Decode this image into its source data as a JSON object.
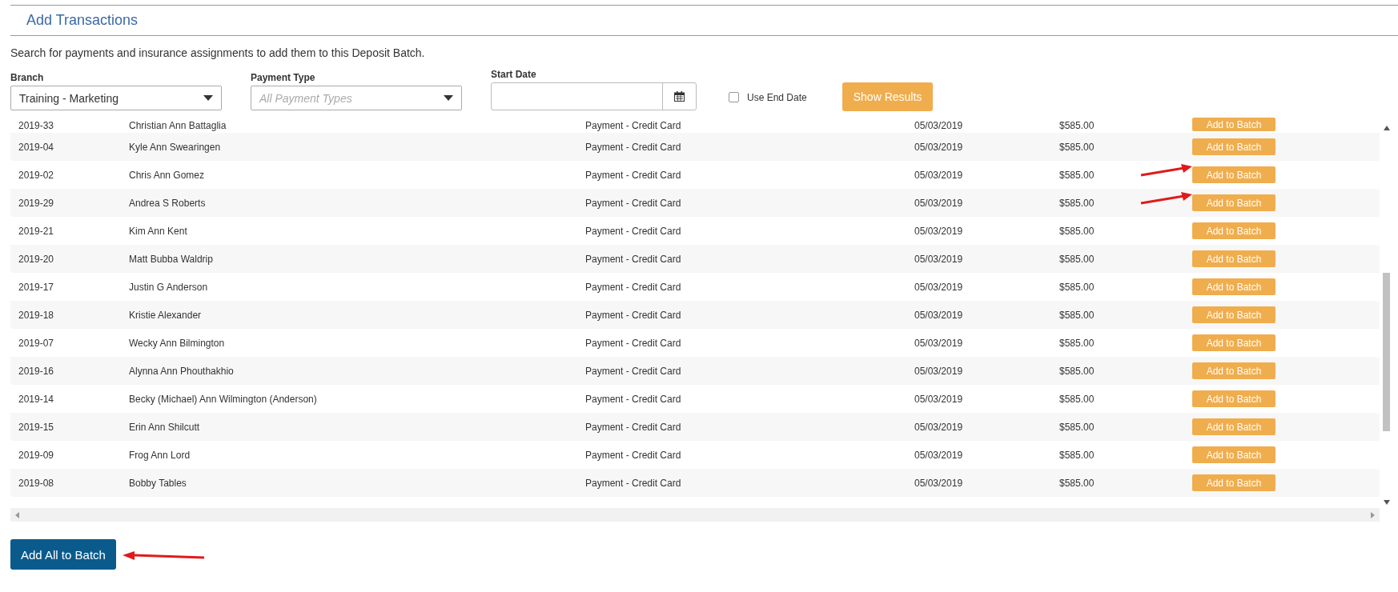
{
  "section": {
    "title": "Add Transactions",
    "description": "Search for payments and insurance assignments to add them to this Deposit Batch."
  },
  "filters": {
    "branch": {
      "label": "Branch",
      "value": "Training - Marketing"
    },
    "payment_type": {
      "label": "Payment Type",
      "placeholder": "All Payment Types"
    },
    "start_date": {
      "label": "Start Date"
    },
    "use_end_date": {
      "label": "Use End Date",
      "checked": false
    },
    "show_results": "Show Results"
  },
  "rows": [
    {
      "id": "2019-33",
      "name": "Christian Ann Battaglia",
      "type": "Payment - Credit Card",
      "date": "05/03/2019",
      "amount": "$585.00",
      "action": "Add to Batch"
    },
    {
      "id": "2019-04",
      "name": "Kyle Ann Swearingen",
      "type": "Payment - Credit Card",
      "date": "05/03/2019",
      "amount": "$585.00",
      "action": "Add to Batch"
    },
    {
      "id": "2019-02",
      "name": "Chris Ann Gomez",
      "type": "Payment - Credit Card",
      "date": "05/03/2019",
      "amount": "$585.00",
      "action": "Add to Batch"
    },
    {
      "id": "2019-29",
      "name": "Andrea S Roberts",
      "type": "Payment - Credit Card",
      "date": "05/03/2019",
      "amount": "$585.00",
      "action": "Add to Batch"
    },
    {
      "id": "2019-21",
      "name": "Kim Ann Kent",
      "type": "Payment - Credit Card",
      "date": "05/03/2019",
      "amount": "$585.00",
      "action": "Add to Batch"
    },
    {
      "id": "2019-20",
      "name": "Matt Bubba Waldrip",
      "type": "Payment - Credit Card",
      "date": "05/03/2019",
      "amount": "$585.00",
      "action": "Add to Batch"
    },
    {
      "id": "2019-17",
      "name": "Justin G Anderson",
      "type": "Payment - Credit Card",
      "date": "05/03/2019",
      "amount": "$585.00",
      "action": "Add to Batch"
    },
    {
      "id": "2019-18",
      "name": "Kristie Alexander",
      "type": "Payment - Credit Card",
      "date": "05/03/2019",
      "amount": "$585.00",
      "action": "Add to Batch"
    },
    {
      "id": "2019-07",
      "name": "Wecky Ann Bilmington",
      "type": "Payment - Credit Card",
      "date": "05/03/2019",
      "amount": "$585.00",
      "action": "Add to Batch"
    },
    {
      "id": "2019-16",
      "name": "Alynna Ann Phouthakhio",
      "type": "Payment - Credit Card",
      "date": "05/03/2019",
      "amount": "$585.00",
      "action": "Add to Batch"
    },
    {
      "id": "2019-14",
      "name": "Becky (Michael) Ann Wilmington (Anderson)",
      "type": "Payment - Credit Card",
      "date": "05/03/2019",
      "amount": "$585.00",
      "action": "Add to Batch"
    },
    {
      "id": "2019-15",
      "name": "Erin Ann Shilcutt",
      "type": "Payment - Credit Card",
      "date": "05/03/2019",
      "amount": "$585.00",
      "action": "Add to Batch"
    },
    {
      "id": "2019-09",
      "name": "Frog Ann Lord",
      "type": "Payment - Credit Card",
      "date": "05/03/2019",
      "amount": "$585.00",
      "action": "Add to Batch"
    },
    {
      "id": "2019-08",
      "name": "Bobby Tables",
      "type": "Payment - Credit Card",
      "date": "05/03/2019",
      "amount": "$585.00",
      "action": "Add to Batch"
    }
  ],
  "add_all": "Add All to Batch"
}
